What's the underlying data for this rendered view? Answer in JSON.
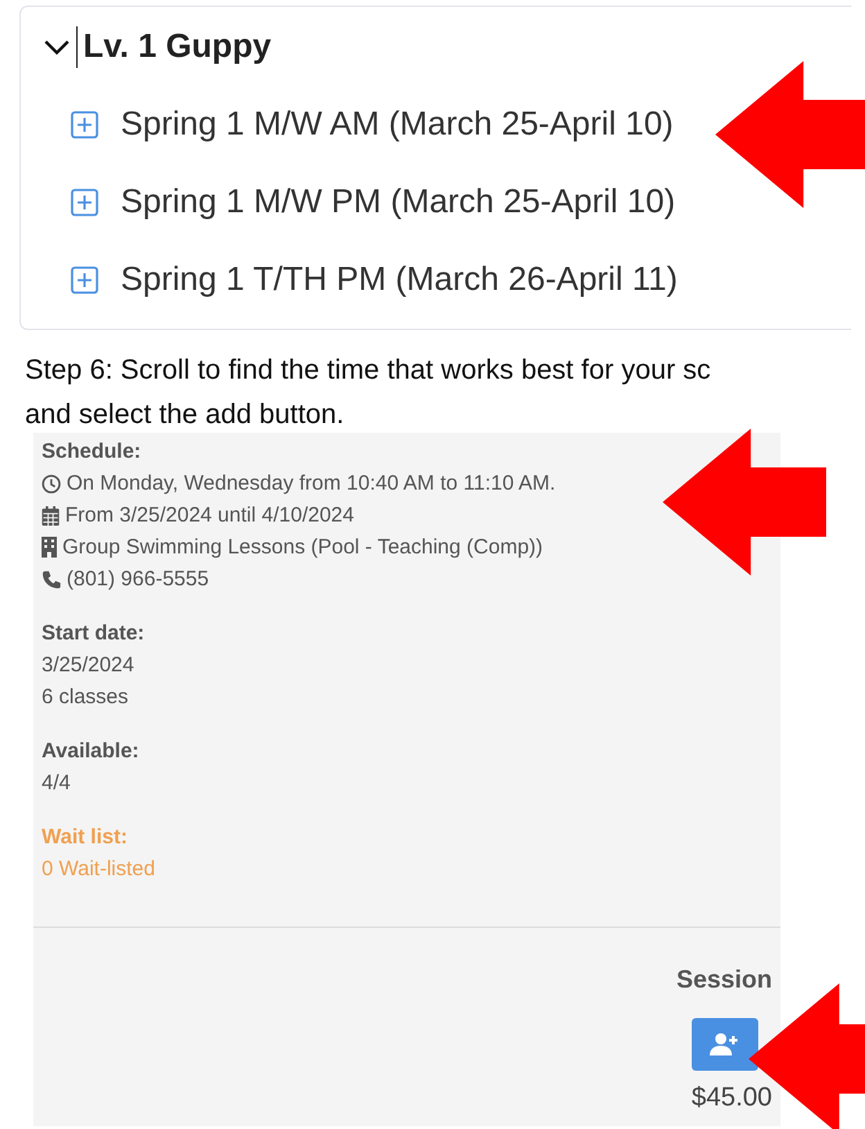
{
  "course": {
    "title": "Lv. 1 Guppy",
    "expanded": true,
    "sessions": [
      {
        "label": "Spring 1 M/W AM (March 25-April 10)"
      },
      {
        "label": "Spring 1 M/W PM (March 25-April 10)"
      },
      {
        "label": "Spring 1 T/TH PM (March 26-April 11)"
      }
    ]
  },
  "instruction": [
    "Step 6: Scroll to find the time that works best for your sc",
    "and select the add button."
  ],
  "details": {
    "schedule_heading": "Schedule:",
    "schedule": [
      {
        "kind": "clock",
        "text": "On Monday, Wednesday from 10:40 AM to 11:10 AM."
      },
      {
        "kind": "calendar",
        "text": "From 3/25/2024 until 4/10/2024"
      },
      {
        "kind": "building",
        "text": "Group Swimming Lessons (Pool - Teaching (Comp))"
      },
      {
        "kind": "phone",
        "text": "(801) 966-5555"
      }
    ],
    "start_heading": "Start date:",
    "start_lines": [
      "3/25/2024",
      "6 classes"
    ],
    "available_heading": "Available:",
    "available": "4/4",
    "waitlist_heading": "Wait list:",
    "waitlist": "0 Wait-listed",
    "session_heading": "Session",
    "price": "$45.00"
  }
}
